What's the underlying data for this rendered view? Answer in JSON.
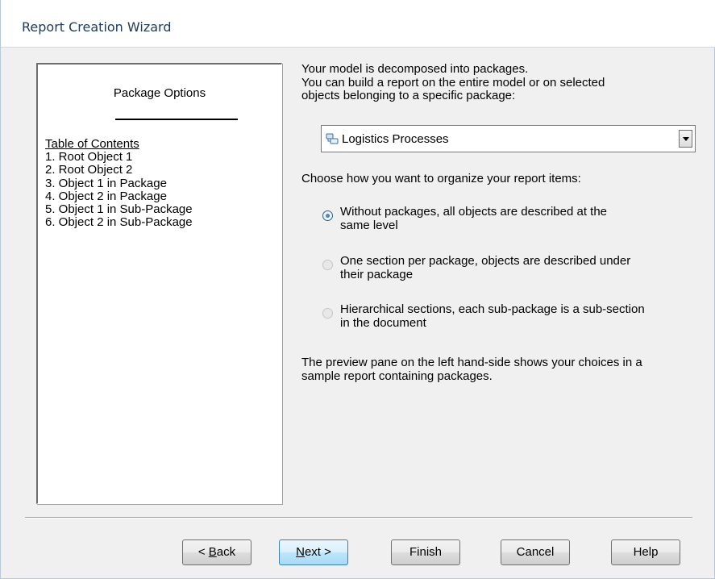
{
  "window": {
    "title": "Report Creation Wizard"
  },
  "preview": {
    "title": "Package Options",
    "toc_heading": "Table of Contents",
    "items": [
      "1. Root Object 1",
      "2. Root Object 2",
      "3. Object 1 in Package",
      "4. Object 2 in Package",
      "5. Object 1 in Sub-Package",
      "6. Object 2 in Sub-Package"
    ]
  },
  "intro": {
    "line1": "Your model is decomposed into packages.",
    "line2": "You can build a report on the entire model or on selected",
    "line3": "objects belonging to a specific package:"
  },
  "package_select": {
    "value": "Logistics Processes",
    "icon": "package-icon"
  },
  "organize_prompt": "Choose how you want to organize your report items:",
  "options": [
    {
      "line1": "Without packages, all objects are described at the",
      "line2": "same level",
      "checked": true
    },
    {
      "line1": "One section per package, objects are described under",
      "line2": "their package",
      "checked": false
    },
    {
      "line1": "Hierarchical sections, each sub-package is a sub-section",
      "line2": "in the document",
      "checked": false
    }
  ],
  "footer_note": {
    "line1": "The preview pane on the left hand-side shows your choices in a",
    "line2": "sample report containing packages."
  },
  "buttons": {
    "back_mnemonic": "B",
    "back_rest": "ack",
    "back_prefix": "< ",
    "next_mnemonic": "N",
    "next_rest": "ext >",
    "finish": "Finish",
    "cancel": "Cancel",
    "help": "Help"
  },
  "colors": {
    "title": "#1e395b",
    "default_button": "#a7d9f5",
    "accent": "#1d5d9b"
  }
}
